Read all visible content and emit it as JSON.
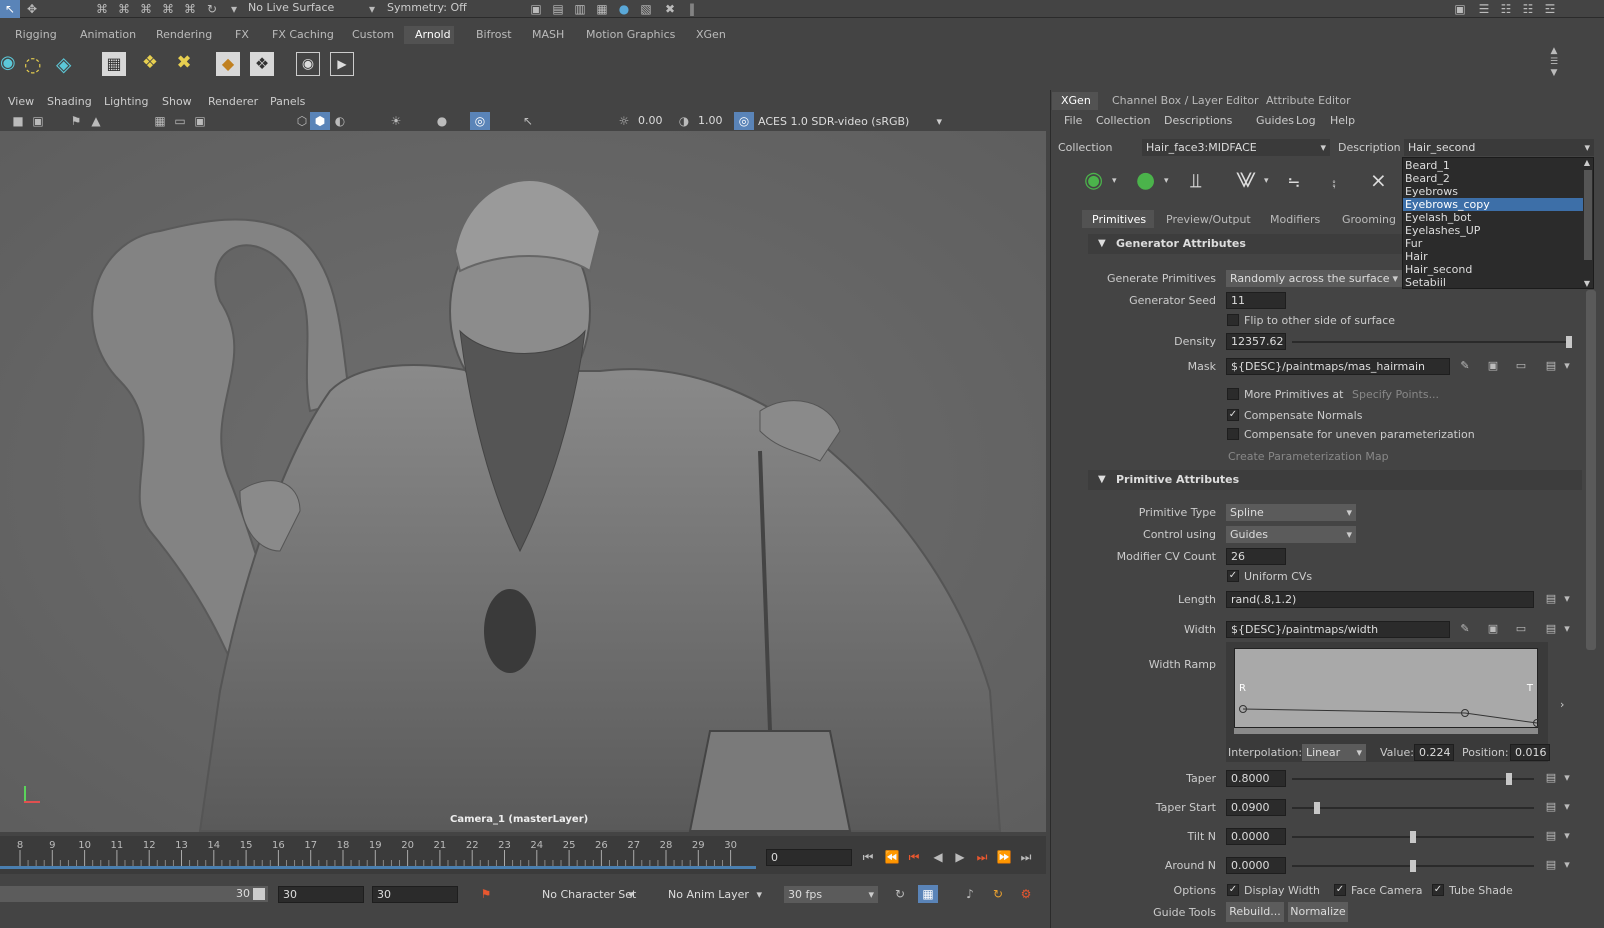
{
  "statusline": {
    "live_surface": "No Live Surface",
    "symmetry": "Symmetry: Off"
  },
  "shelf_tabs": [
    "Rigging",
    "Animation",
    "Rendering",
    "FX",
    "FX Caching",
    "Custom",
    "Arnold",
    "Bifrost",
    "MASH",
    "Motion Graphics",
    "XGen"
  ],
  "shelf_active": "Arnold",
  "viewport": {
    "menus": [
      "View",
      "Shading",
      "Lighting",
      "Show",
      "Renderer",
      "Panels"
    ],
    "exposure": "0.00",
    "gamma": "1.00",
    "color_space": "ACES 1.0 SDR-video (sRGB)",
    "camera_label": "Camera_1 (masterLayer)"
  },
  "timeline": {
    "ticks": [
      "8",
      "9",
      "10",
      "11",
      "12",
      "13",
      "14",
      "15",
      "16",
      "17",
      "18",
      "19",
      "20",
      "21",
      "22",
      "23",
      "24",
      "25",
      "26",
      "27",
      "28",
      "29",
      "30"
    ],
    "current_frame": "0"
  },
  "range": {
    "slider_end": "30",
    "start": "30",
    "end": "30",
    "character_set": "No Character Set",
    "anim_layer": "No Anim Layer",
    "fps": "30 fps"
  },
  "panel_tabs": [
    "XGen",
    "Channel Box / Layer Editor",
    "Attribute Editor"
  ],
  "xgen": {
    "menu": [
      "File",
      "Collection",
      "Descriptions",
      "Guides",
      "Log",
      "Help"
    ],
    "collection_label": "Collection",
    "collection_value": "Hair_face3:MIDFACE",
    "description_label": "Description",
    "description_value": "Hair_second",
    "description_options": [
      "Beard_1",
      "Beard_2",
      "Eyebrows",
      "Eyebrows_copy",
      "Eyelash_bot",
      "Eyelashes_UP",
      "Fur",
      "Hair",
      "Hair_second",
      "Setabiil"
    ],
    "description_highlight": "Eyebrows_copy",
    "tabs": [
      "Primitives",
      "Preview/Output",
      "Modifiers",
      "Grooming"
    ],
    "generator": {
      "title": "Generator Attributes",
      "gen_prims_label": "Generate Primitives",
      "gen_prims_value": "Randomly across the surface",
      "seed_label": "Generator Seed",
      "seed_value": "11",
      "flip_label": "Flip to other side of surface",
      "density_label": "Density",
      "density_value": "12357.62",
      "density_level": 1.0,
      "mask_label": "Mask",
      "mask_value": "${DESC}/paintmaps/mas_hairmain",
      "more_prims_label": "More Primitives at",
      "specify_points": "Specify Points...",
      "comp_normals_label": "Compensate Normals",
      "comp_uneven_label": "Compensate for uneven parameterization",
      "create_param_map": "Create Parameterization Map"
    },
    "primitive": {
      "title": "Primitive Attributes",
      "type_label": "Primitive Type",
      "type_value": "Spline",
      "control_label": "Control using",
      "control_value": "Guides",
      "cv_label": "Modifier CV Count",
      "cv_value": "26",
      "uniform_label": "Uniform CVs",
      "length_label": "Length",
      "length_value": "rand(.8,1.2)",
      "width_label": "Width",
      "width_value": "${DESC}/paintmaps/width",
      "ramp_label": "Width Ramp",
      "ramp_r": "R",
      "ramp_t": "T",
      "interp_label": "Interpolation:",
      "interp_value": "Linear",
      "value_label": "Value:",
      "value_value": "0.224",
      "position_label": "Position:",
      "position_value": "0.016",
      "taper_label": "Taper",
      "taper_value": "0.8000",
      "taper_start_label": "Taper Start",
      "taper_start_value": "0.0900",
      "tilt_label": "Tilt N",
      "tilt_value": "0.0000",
      "around_label": "Around N",
      "around_value": "0.0000",
      "options_label": "Options",
      "display_width": "Display Width",
      "face_camera": "Face Camera",
      "tube_shade": "Tube Shade",
      "guide_tools_label": "Guide Tools",
      "rebuild": "Rebuild...",
      "normalize": "Normalize"
    }
  },
  "colors": {
    "highlight": "#3d6fa8",
    "accent_green": "#4bb34b",
    "timeline_red": "#e8572f"
  }
}
